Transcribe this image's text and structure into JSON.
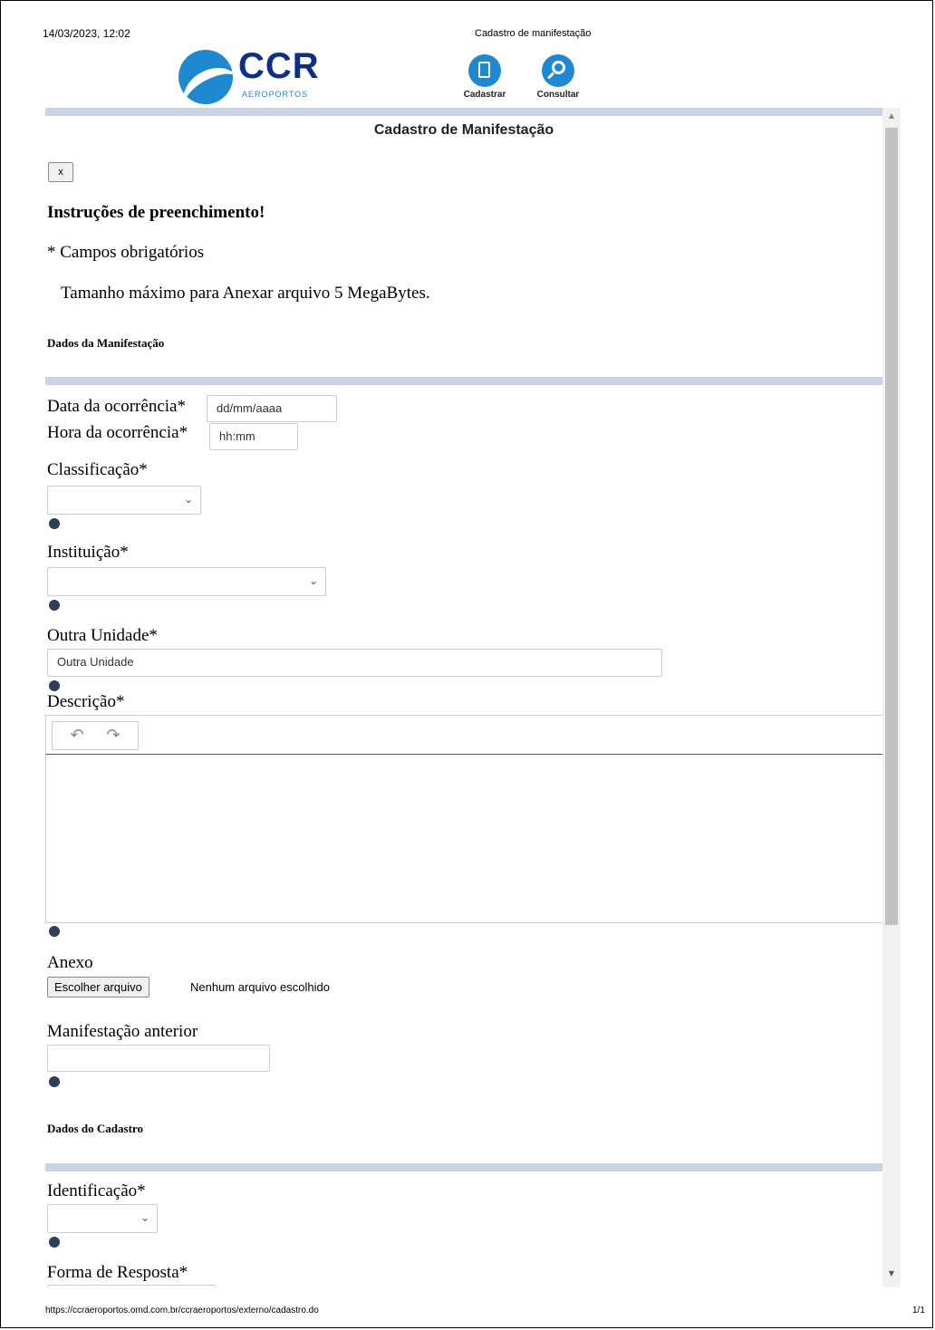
{
  "print_header": {
    "datetime": "14/03/2023, 12:02",
    "title": "Cadastro de manifestação"
  },
  "logo": {
    "text": "CCR",
    "sub": "AEROPORTOS"
  },
  "top_nav": {
    "register_label": "Cadastrar",
    "search_label": "Consultar"
  },
  "form": {
    "title": "Cadastro de Manifestação",
    "close_label": "x",
    "instructions_title": "Instruções de preenchimento!",
    "required_note": "* Campos obrigatórios",
    "max_size_note": "Tamanho máximo para Anexar arquivo 5 MegaBytes.",
    "section_manifestation": "Dados da Manifestação",
    "date_label": "Data da ocorrência*",
    "date_placeholder": "dd/mm/aaaa",
    "time_label": "Hora da ocorrência*",
    "time_placeholder": "hh:mm",
    "classification_label": "Classificação*",
    "institution_label": "Instituição*",
    "other_unit_label": "Outra Unidade*",
    "other_unit_placeholder": "Outra Unidade",
    "description_label": "Descrição*",
    "attachment_label": "Anexo",
    "choose_file_label": "Escolher arquivo",
    "no_file_label": "Nenhum arquivo escolhido",
    "previous_label": "Manifestação anterior",
    "section_registration": "Dados do Cadastro",
    "identification_label": "Identificação*",
    "response_form_label": "Forma de Resposta*"
  },
  "print_footer": {
    "url": "https://ccraeroportos.omd.com.br/ccraeroportos/externo/cadastro.do",
    "page": "1/1"
  },
  "colors": {
    "accent": "#1e88d0",
    "logo_dark": "#0d2f86",
    "section_bar": "#c9d3e4",
    "help_icon": "#2b3f58"
  }
}
